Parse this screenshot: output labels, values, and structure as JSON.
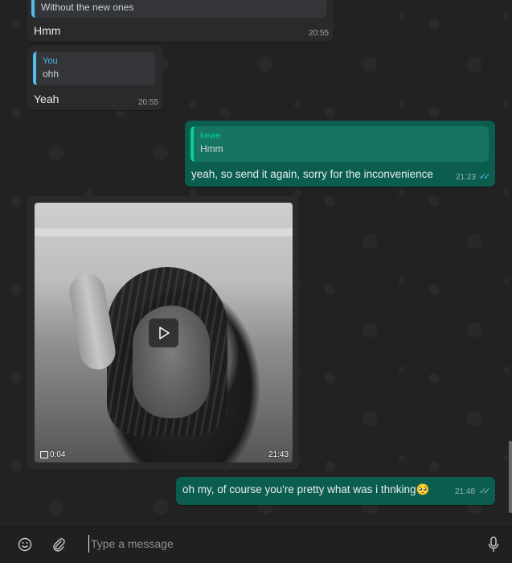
{
  "messages": [
    {
      "id": "m1",
      "text": "Hmm",
      "time": "20:55",
      "quote_partial": "Without the new ones"
    },
    {
      "id": "m2",
      "quote_author": "You",
      "quote_text": "ohh",
      "text": "Yeah",
      "time": "20:55"
    },
    {
      "id": "m3",
      "quote_author": "kewe",
      "quote_text": "Hmm",
      "text": "yeah, so send it again, sorry for the inconvenience",
      "time": "21:23",
      "status": "read"
    },
    {
      "id": "m4",
      "type": "video",
      "duration": "0:04",
      "time": "21:43"
    },
    {
      "id": "m5",
      "text": "oh my, of course you're pretty what was i thnking🥺",
      "time": "21:48",
      "status": "read"
    }
  ],
  "composer": {
    "placeholder": "Type a message",
    "emoji_icon": "emoji-icon",
    "attach_icon": "paperclip-icon",
    "mic_icon": "microphone-icon"
  },
  "colors": {
    "incoming_bubble": "#2a2a2a",
    "outgoing_bubble": "#0b5e4f",
    "read_ticks": "#53bdeb"
  }
}
